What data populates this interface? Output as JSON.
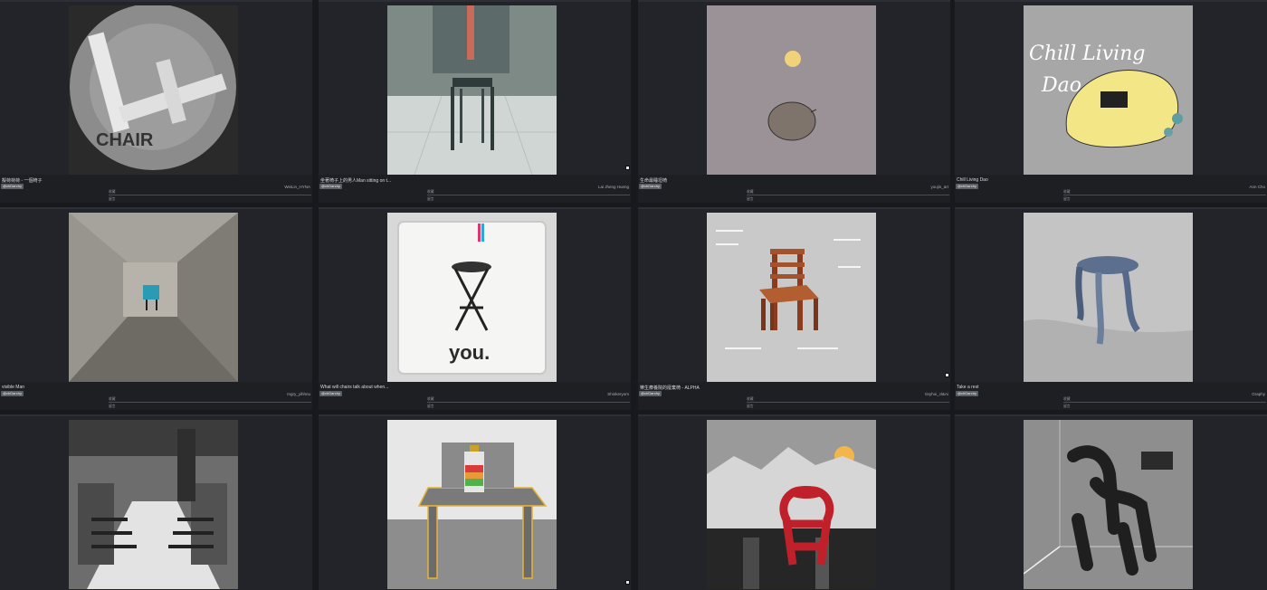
{
  "cards": [
    {
      "title": "擬荷荷荷 - 一個椅子",
      "author": "WeiLin_HYNA",
      "tag": "@chDarchy",
      "row1": "收藏",
      "row2": "留言",
      "has_meta": true
    },
    {
      "title": "坐著椅子上的男人Man sitting on t...",
      "author": "Lai Jheng Hueng",
      "tag": "@chDarchy",
      "row1": "收藏",
      "row2": "留言",
      "has_meta": true,
      "media_icon": "video-icon"
    },
    {
      "title": "生命最睡坦椅",
      "author": "youjin_art",
      "tag": "@chDarchy",
      "row1": "收藏",
      "row2": "留言",
      "has_meta": true
    },
    {
      "title": "Chill Living Dao",
      "author": "Ann Cho",
      "tag": "@chDarchy",
      "row1": "收藏",
      "row2": "留言",
      "has_meta": true,
      "art_text_1": "Chill Living",
      "art_text_2": "Dao"
    },
    {
      "title": "visible Man",
      "author": "Ingry_yihhnu",
      "tag": "@chDarchy",
      "row1": "收藏",
      "row2": "留言",
      "has_meta": true
    },
    {
      "title": "What will chairs talk about when...",
      "author": "Shinkeryom",
      "tag": "@chDarchy",
      "row1": "收藏",
      "row2": "留言",
      "has_meta": true,
      "art_text_1": "you."
    },
    {
      "title": "樂生療養院的廢棄椅 - ALPHA",
      "author": "tinyhoi_cl&Ai",
      "tag": "@chDarchy",
      "row1": "收藏",
      "row2": "留言",
      "has_meta": true,
      "media_icon": "video-icon"
    },
    {
      "title": "Take a rest",
      "author": "Graphy",
      "tag": "@chDarchy",
      "row1": "收藏",
      "row2": "留言",
      "has_meta": true
    },
    {
      "title": "",
      "author": "",
      "tag": "",
      "row1": "",
      "row2": "",
      "has_meta": false
    },
    {
      "title": "",
      "author": "",
      "tag": "",
      "row1": "",
      "row2": "",
      "has_meta": false,
      "media_icon": "video-icon"
    },
    {
      "title": "",
      "author": "",
      "tag": "",
      "row1": "",
      "row2": "",
      "has_meta": false
    },
    {
      "title": "",
      "author": "",
      "tag": "",
      "row1": "",
      "row2": "",
      "has_meta": false
    }
  ]
}
